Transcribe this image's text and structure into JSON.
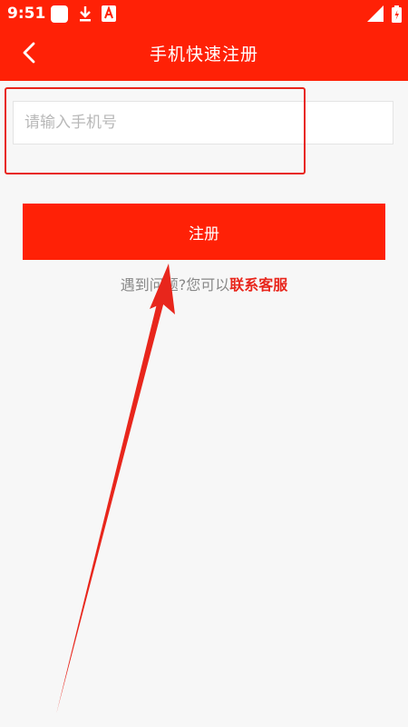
{
  "status_bar": {
    "time": "9:51",
    "icons": [
      "square-app-icon",
      "download-icon",
      "app-a-icon",
      "signal-icon",
      "battery-icon"
    ]
  },
  "header": {
    "back_icon": "chevron-left-icon",
    "title": "手机快速注册"
  },
  "form": {
    "phone_value": "",
    "phone_placeholder": "请输入手机号",
    "register_label": "注册"
  },
  "help": {
    "text": "遇到问题?您可以",
    "link_text": "联系客服"
  },
  "colors": {
    "brand": "#ff2106",
    "annotation": "#e8261c",
    "background": "#f7f7f7"
  }
}
